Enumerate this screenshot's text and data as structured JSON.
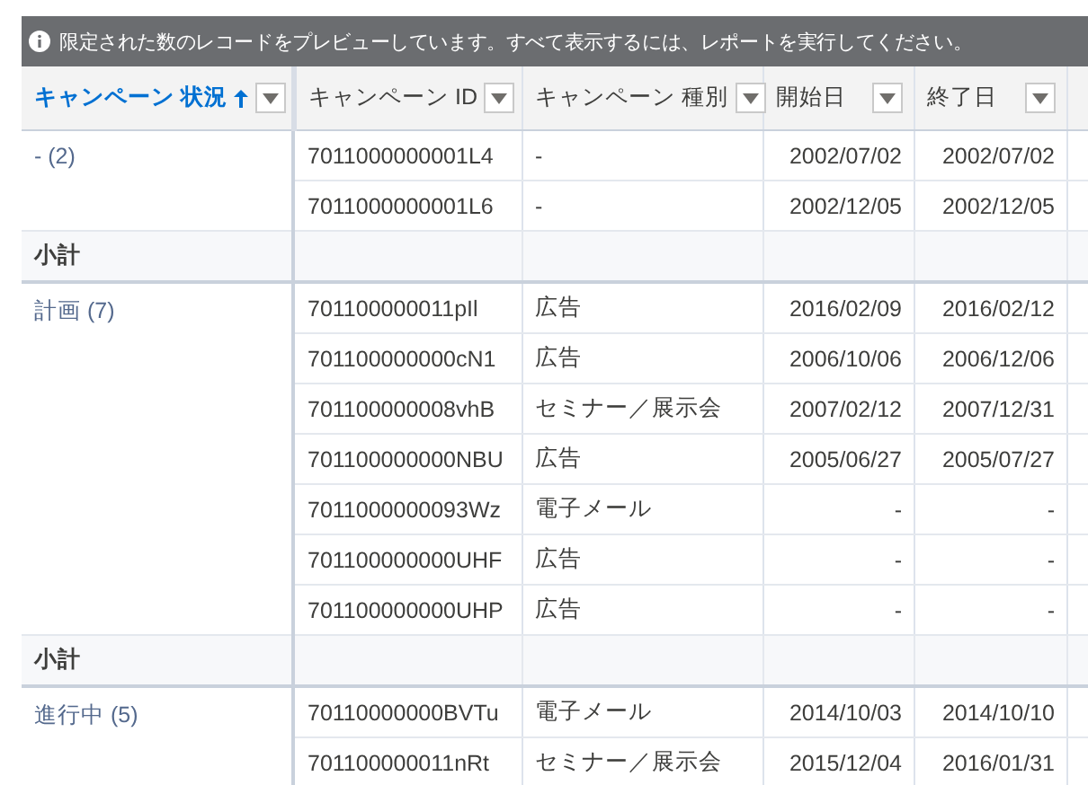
{
  "banner": {
    "text": "限定された数のレコードをプレビューしています。すべて表示するには、レポートを実行してください。"
  },
  "columns": [
    {
      "label": "キャンペーン 状況",
      "sorted": true
    },
    {
      "label": "キャンペーン ID",
      "sorted": false
    },
    {
      "label": "キャンペーン 種別",
      "sorted": false
    },
    {
      "label": "開始日",
      "sorted": false
    },
    {
      "label": "終了日",
      "sorted": false
    }
  ],
  "groups": [
    {
      "label": "- (2)",
      "subtotal": "小計",
      "rows": [
        {
          "id": "7011000000001L4",
          "type": "-",
          "start": "2002/07/02",
          "end": "2002/07/02"
        },
        {
          "id": "7011000000001L6",
          "type": "-",
          "start": "2002/12/05",
          "end": "2002/12/05"
        }
      ]
    },
    {
      "label": "計画 (7)",
      "subtotal": "小計",
      "rows": [
        {
          "id": "701100000011pIl",
          "type": "広告",
          "start": "2016/02/09",
          "end": "2016/02/12"
        },
        {
          "id": "701100000000cN1",
          "type": "広告",
          "start": "2006/10/06",
          "end": "2006/12/06"
        },
        {
          "id": "701100000008vhB",
          "type": "セミナー／展示会",
          "start": "2007/02/12",
          "end": "2007/12/31"
        },
        {
          "id": "701100000000NBU",
          "type": "広告",
          "start": "2005/06/27",
          "end": "2005/07/27"
        },
        {
          "id": "7011000000093Wz",
          "type": "電子メール",
          "start": "-",
          "end": "-"
        },
        {
          "id": "701100000000UHF",
          "type": "広告",
          "start": "-",
          "end": "-"
        },
        {
          "id": "701100000000UHP",
          "type": "広告",
          "start": "-",
          "end": "-"
        }
      ]
    },
    {
      "label": "進行中 (5)",
      "rows": [
        {
          "id": "70110000000BVTu",
          "type": "電子メール",
          "start": "2014/10/03",
          "end": "2014/10/10"
        },
        {
          "id": "701100000011nRt",
          "type": "セミナー／展示会",
          "start": "2015/12/04",
          "end": "2016/01/31"
        }
      ]
    }
  ]
}
